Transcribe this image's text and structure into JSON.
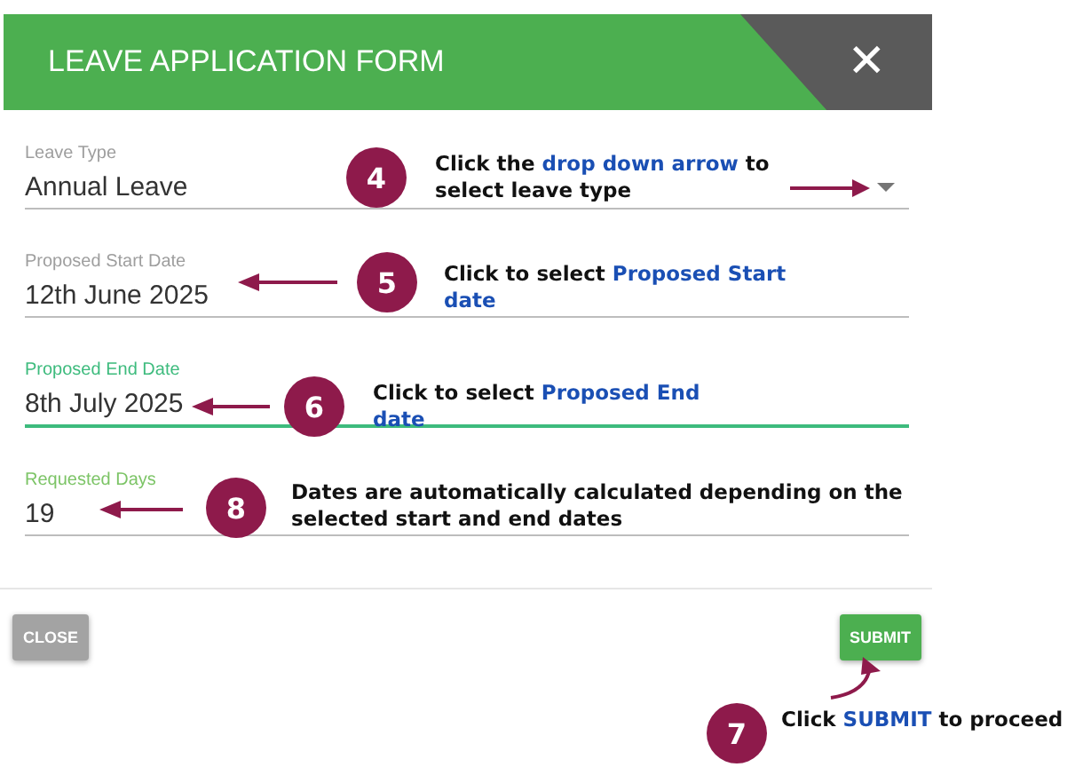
{
  "dialog": {
    "title": "LEAVE APPLICATION FORM",
    "close_icon": "✕"
  },
  "fields": [
    {
      "kind": "select",
      "label": "Leave Type",
      "value": "Annual Leave",
      "focused": false,
      "color": "#9e9e9e"
    },
    {
      "kind": "text",
      "label": "Proposed Start Date",
      "value": "12th June 2025",
      "focused": false,
      "color": "#9e9e9e"
    },
    {
      "kind": "text",
      "label": "Proposed End Date",
      "value": "8th July 2025",
      "focused": true,
      "color": "#3dbb7d"
    },
    {
      "kind": "text",
      "label": "Requested Days",
      "value": "19",
      "focused": false,
      "color": "#7cc466"
    }
  ],
  "buttons": [
    {
      "label": "CLOSE",
      "kind": "secondary"
    },
    {
      "label": "SUBMIT",
      "kind": "primary"
    }
  ],
  "callouts": [
    {
      "number": "4",
      "text": "Click the **drop down arrow** to select leave type"
    },
    {
      "number": "5",
      "text": "Click to select **Proposed Start date**"
    },
    {
      "number": "6",
      "text": "Click to select **Proposed End date**"
    },
    {
      "number": "8",
      "text": "Dates are automatically calculated depending on the selected start and end dates"
    },
    {
      "number": "7",
      "text": "Click **SUBMIT**  to proceed"
    }
  ]
}
